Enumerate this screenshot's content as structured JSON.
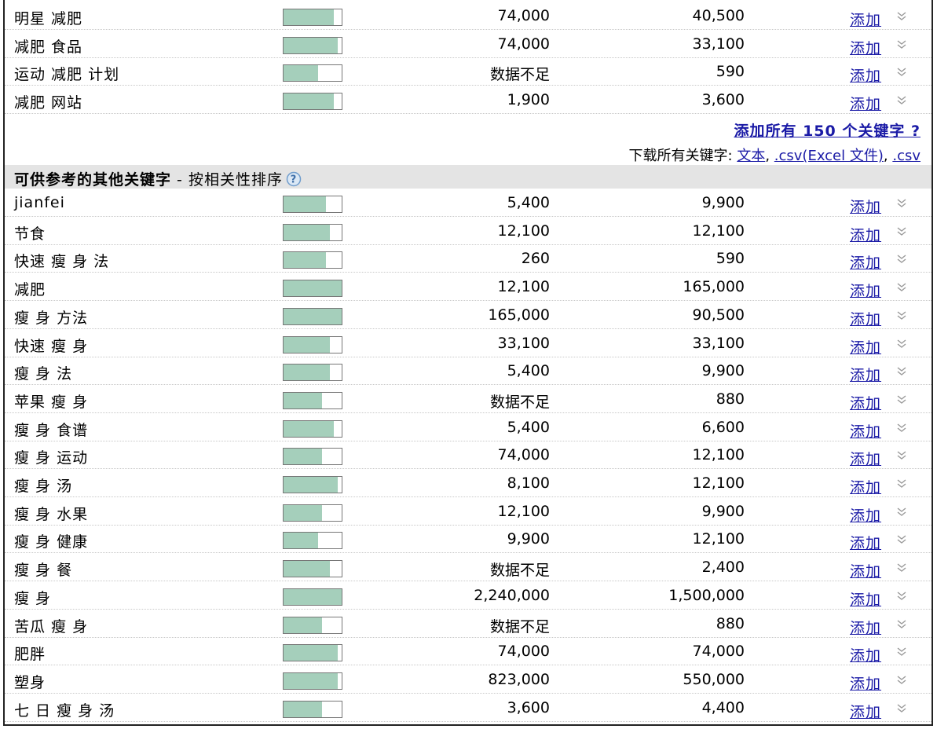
{
  "colors": {
    "link": "#1a1aa6",
    "bar_fill": "#a5cfbb",
    "section_bg": "#e4e4e4"
  },
  "top_rows": [
    {
      "keyword": "明星 减肥",
      "competition": 0.86,
      "search_volume": "74,000",
      "monthly_volume": "40,500",
      "action": "添加"
    },
    {
      "keyword": "减肥 食品",
      "competition": 0.93,
      "search_volume": "74,000",
      "monthly_volume": "33,100",
      "action": "添加"
    },
    {
      "keyword": "运动 减肥 计划",
      "competition": 0.59,
      "search_volume": "数据不足",
      "monthly_volume": "590",
      "action": "添加"
    },
    {
      "keyword": "减肥 网站",
      "competition": 0.86,
      "search_volume": "1,900",
      "monthly_volume": "3,600",
      "action": "添加"
    }
  ],
  "footer": {
    "add_all": "添加所有 150 个关键字 ?",
    "download_label": "下载所有关键字:",
    "links": [
      "文本",
      ".csv(Excel 文件)",
      ".csv"
    ]
  },
  "section": {
    "title": "可供参考的其他关键字",
    "sort": " - 按相关性排序",
    "help_icon": "question-mark"
  },
  "other_rows": [
    {
      "keyword": "jianfei",
      "competition": 0.73,
      "search_volume": "5,400",
      "monthly_volume": "9,900",
      "action": "添加"
    },
    {
      "keyword": "节食",
      "competition": 0.8,
      "search_volume": "12,100",
      "monthly_volume": "12,100",
      "action": "添加"
    },
    {
      "keyword": "快速 瘦 身 法",
      "competition": 0.73,
      "search_volume": "260",
      "monthly_volume": "590",
      "action": "添加"
    },
    {
      "keyword": "减肥",
      "competition": 1.0,
      "search_volume": "12,100",
      "monthly_volume": "165,000",
      "action": "添加"
    },
    {
      "keyword": "瘦 身 方法",
      "competition": 1.0,
      "search_volume": "165,000",
      "monthly_volume": "90,500",
      "action": "添加"
    },
    {
      "keyword": "快速 瘦 身",
      "competition": 0.8,
      "search_volume": "33,100",
      "monthly_volume": "33,100",
      "action": "添加"
    },
    {
      "keyword": "瘦 身 法",
      "competition": 0.8,
      "search_volume": "5,400",
      "monthly_volume": "9,900",
      "action": "添加"
    },
    {
      "keyword": "苹果 瘦 身",
      "competition": 0.66,
      "search_volume": "数据不足",
      "monthly_volume": "880",
      "action": "添加"
    },
    {
      "keyword": "瘦 身 食谱",
      "competition": 0.86,
      "search_volume": "5,400",
      "monthly_volume": "6,600",
      "action": "添加"
    },
    {
      "keyword": "瘦 身 运动",
      "competition": 0.66,
      "search_volume": "74,000",
      "monthly_volume": "12,100",
      "action": "添加"
    },
    {
      "keyword": "瘦 身 汤",
      "competition": 0.93,
      "search_volume": "8,100",
      "monthly_volume": "12,100",
      "action": "添加"
    },
    {
      "keyword": "瘦 身 水果",
      "competition": 0.66,
      "search_volume": "12,100",
      "monthly_volume": "9,900",
      "action": "添加"
    },
    {
      "keyword": "瘦 身 健康",
      "competition": 0.59,
      "search_volume": "9,900",
      "monthly_volume": "12,100",
      "action": "添加"
    },
    {
      "keyword": "瘦 身 餐",
      "competition": 0.8,
      "search_volume": "数据不足",
      "monthly_volume": "2,400",
      "action": "添加"
    },
    {
      "keyword": "瘦 身",
      "competition": 1.0,
      "search_volume": "2,240,000",
      "monthly_volume": "1,500,000",
      "action": "添加"
    },
    {
      "keyword": "苦瓜 瘦 身",
      "competition": 0.66,
      "search_volume": "数据不足",
      "monthly_volume": "880",
      "action": "添加"
    },
    {
      "keyword": "肥胖",
      "competition": 0.93,
      "search_volume": "74,000",
      "monthly_volume": "74,000",
      "action": "添加"
    },
    {
      "keyword": "塑身",
      "competition": 0.93,
      "search_volume": "823,000",
      "monthly_volume": "550,000",
      "action": "添加"
    },
    {
      "keyword": "七 日 瘦 身 汤",
      "competition": 0.66,
      "search_volume": "3,600",
      "monthly_volume": "4,400",
      "action": "添加"
    }
  ]
}
